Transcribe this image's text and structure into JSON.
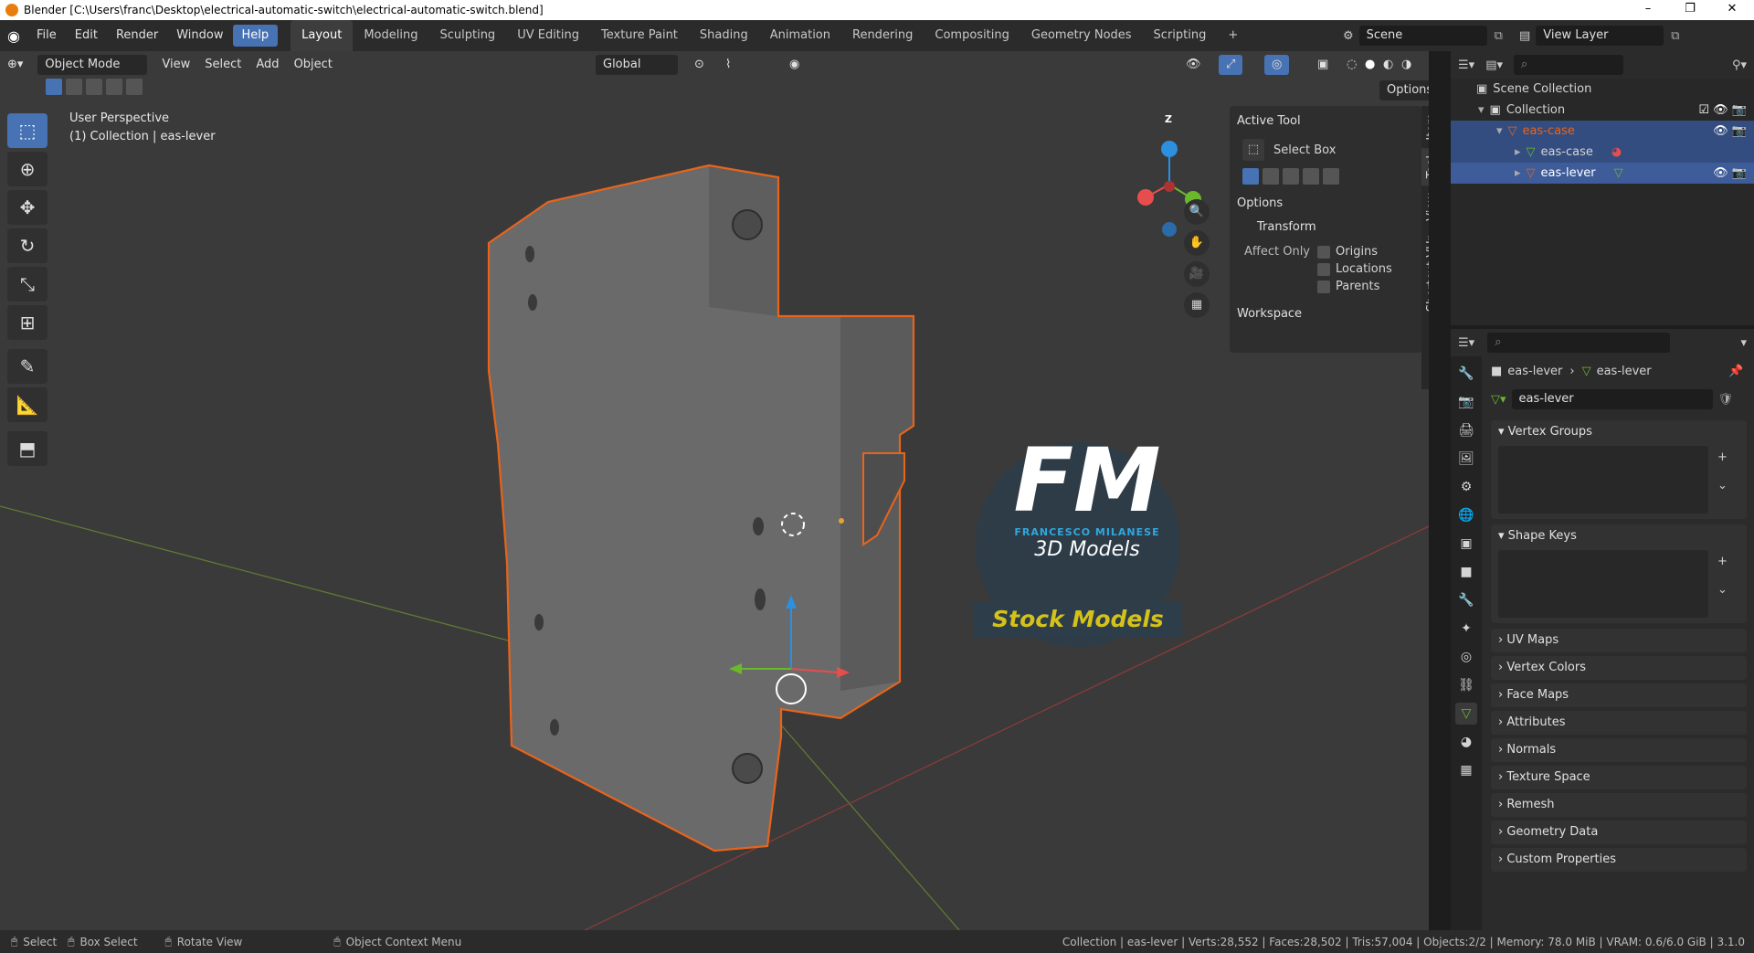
{
  "title": "Blender [C:\\Users\\franc\\Desktop\\electrical-automatic-switch\\electrical-automatic-switch.blend]",
  "window_controls": [
    "–",
    "❐",
    "✕"
  ],
  "menu": [
    "File",
    "Edit",
    "Render",
    "Window",
    "Help"
  ],
  "workspaces": [
    "Layout",
    "Modeling",
    "Sculpting",
    "UV Editing",
    "Texture Paint",
    "Shading",
    "Animation",
    "Rendering",
    "Compositing",
    "Geometry Nodes",
    "Scripting",
    "+"
  ],
  "scene_label": "Scene",
  "view_layer_label": "View Layer",
  "viewport": {
    "mode": "Object Mode",
    "menus": [
      "View",
      "Select",
      "Add",
      "Object"
    ],
    "transform": "Global",
    "options": "Options",
    "perspective": "User Perspective",
    "collection_info": "(1) Collection | eas-lever"
  },
  "npanel": {
    "active_tool": "Active Tool",
    "select_box": "Select Box",
    "options": "Options",
    "transform": "Transform",
    "affect_only": "Affect Only",
    "origins": "Origins",
    "locations": "Locations",
    "parents": "Parents",
    "workspace": "Workspace",
    "tabs": [
      "Item",
      "Tool",
      "View",
      "Shortcut VUr"
    ]
  },
  "gizmo": {
    "z": "Z"
  },
  "watermark": {
    "initials": "FM",
    "name": "FRANCESCO MILANESE",
    "sub": "3D Models",
    "stock": "Stock Models"
  },
  "outliner": {
    "scene_collection": "Scene Collection",
    "collection": "Collection",
    "items": [
      {
        "name": "eas-case",
        "level": 2
      },
      {
        "name": "eas-case",
        "level": 3
      },
      {
        "name": "eas-lever",
        "level": 3
      }
    ]
  },
  "properties": {
    "breadcrumb_obj": "eas-lever",
    "breadcrumb_data": "eas-lever",
    "datablock": "eas-lever",
    "panels": [
      "Vertex Groups",
      "Shape Keys"
    ],
    "collapsed": [
      "UV Maps",
      "Vertex Colors",
      "Face Maps",
      "Attributes",
      "Normals",
      "Texture Space",
      "Remesh",
      "Geometry Data",
      "Custom Properties"
    ]
  },
  "status": {
    "select": "Select",
    "box_select": "Box Select",
    "rotate_view": "Rotate View",
    "context_menu": "Object Context Menu",
    "stats": "Collection | eas-lever | Verts:28,552 | Faces:28,502 | Tris:57,004 | Objects:2/2 | Memory: 78.0 MiB | VRAM: 0.6/6.0 GiB | 3.1.0"
  },
  "colors": {
    "accent": "#4772b3",
    "selection": "#e8641b",
    "z_axis": "#2c8fe0",
    "x_axis": "#e84d4d",
    "y_axis": "#6bb82c"
  }
}
